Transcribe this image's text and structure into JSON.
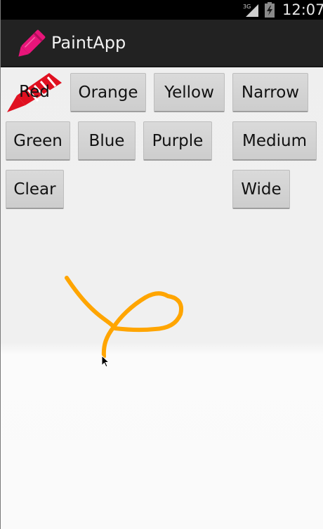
{
  "status_bar": {
    "network_label": "3G",
    "time": "12:07",
    "icons": [
      "signal-icon",
      "battery-charging-icon"
    ]
  },
  "action_bar": {
    "title": "PaintApp",
    "icon": "pencil-icon",
    "icon_color": "#e8157a"
  },
  "colors": {
    "red": {
      "label": "Red",
      "marker_icon": "red-pencil-icon",
      "hex": "#e01020"
    },
    "orange": {
      "label": "Orange"
    },
    "yellow": {
      "label": "Yellow"
    },
    "green": {
      "label": "Green"
    },
    "blue": {
      "label": "Blue"
    },
    "purple": {
      "label": "Purple"
    }
  },
  "actions": {
    "clear": {
      "label": "Clear"
    }
  },
  "widths": {
    "narrow": {
      "label": "Narrow"
    },
    "medium": {
      "label": "Medium"
    },
    "wide": {
      "label": "Wide"
    }
  },
  "canvas": {
    "stroke_color": "#ffa500",
    "cursor": "arrow-cursor-icon"
  }
}
